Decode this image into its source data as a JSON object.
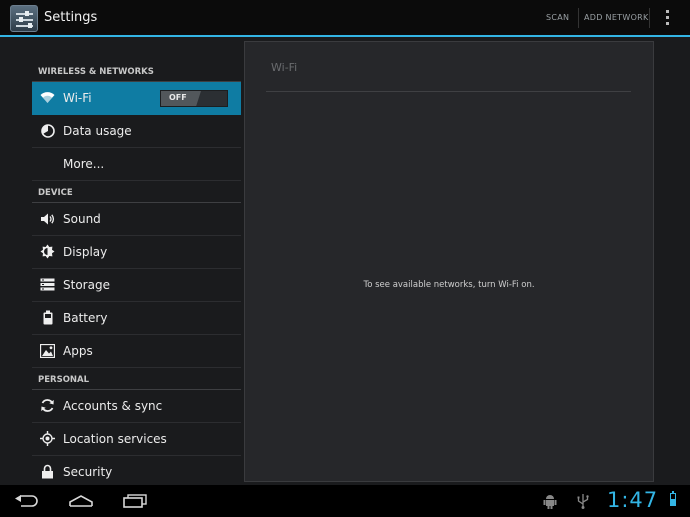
{
  "action_bar": {
    "title": "Settings",
    "scan_label": "SCAN",
    "add_network_label": "ADD NETWORK"
  },
  "sections": [
    {
      "header": "WIRELESS & NETWORKS",
      "items": [
        {
          "label": "Wi-Fi",
          "icon": "wifi-icon",
          "selected": true,
          "toggle": "OFF"
        },
        {
          "label": "Data usage",
          "icon": "data-usage-icon"
        },
        {
          "label": "More...",
          "icon": ""
        }
      ]
    },
    {
      "header": "DEVICE",
      "items": [
        {
          "label": "Sound",
          "icon": "speaker-icon"
        },
        {
          "label": "Display",
          "icon": "brightness-icon"
        },
        {
          "label": "Storage",
          "icon": "storage-icon"
        },
        {
          "label": "Battery",
          "icon": "battery-icon"
        },
        {
          "label": "Apps",
          "icon": "apps-icon"
        }
      ]
    },
    {
      "header": "PERSONAL",
      "items": [
        {
          "label": "Accounts & sync",
          "icon": "sync-icon"
        },
        {
          "label": "Location services",
          "icon": "location-icon"
        },
        {
          "label": "Security",
          "icon": "lock-icon"
        }
      ]
    }
  ],
  "detail": {
    "title": "Wi-Fi",
    "message": "To see available networks, turn Wi-Fi on."
  },
  "status_bar": {
    "time": "1:47",
    "battery_level": 0.55
  },
  "colors": {
    "accent": "#33b5e5",
    "selected_item": "#0f7ca3",
    "background": "#1a1b1d"
  }
}
